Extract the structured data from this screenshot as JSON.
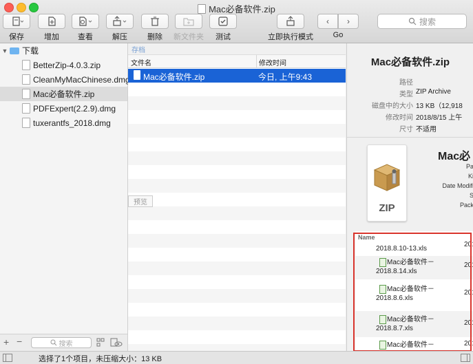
{
  "window": {
    "title": "Mac必备软件.zip"
  },
  "toolbar": {
    "buttons": [
      {
        "label": "保存",
        "icon": "save-icon",
        "enabled": true
      },
      {
        "label": "增加",
        "icon": "add-file-icon",
        "enabled": true
      },
      {
        "label": "查看",
        "icon": "view-icon",
        "enabled": true
      },
      {
        "label": "解压",
        "icon": "extract-icon",
        "enabled": true
      },
      {
        "label": "删除",
        "icon": "trash-icon",
        "enabled": true
      },
      {
        "label": "新文件夹",
        "icon": "new-folder-icon",
        "enabled": false
      },
      {
        "label": "测试",
        "icon": "checkbox-icon",
        "enabled": true
      },
      {
        "label": "立即执行模式",
        "icon": "execute-icon",
        "enabled": true
      },
      {
        "label": "Go",
        "icon": "nav-arrows-icon",
        "enabled": true
      }
    ],
    "search_placeholder": "搜索"
  },
  "sidebar": {
    "root": "下载",
    "items": [
      {
        "label": "BetterZip-4.0.3.zip",
        "selected": false
      },
      {
        "label": "CleanMyMacChinese.dmg",
        "selected": false
      },
      {
        "label": "Mac必备软件.zip",
        "selected": true
      },
      {
        "label": "PDFExpert(2.2.9).dmg",
        "selected": false
      },
      {
        "label": "tuxerantfs_2018.dmg",
        "selected": false
      }
    ],
    "search_placeholder": "搜索"
  },
  "file_list": {
    "archive_tag": "存档",
    "columns": {
      "name": "文件名",
      "modified": "修改时间"
    },
    "rows": [
      {
        "name": "Mac必备软件.zip",
        "modified": "今日, 上午9:43",
        "selected": true
      }
    ],
    "preview_tag": "预览"
  },
  "info": {
    "title": "Mac必备软件.zip",
    "fields": [
      {
        "key": "路径",
        "value": ""
      },
      {
        "key": "类型",
        "value": "ZIP Archive"
      },
      {
        "key": "磁盘中的大小",
        "value": "13 KB（12,918"
      },
      {
        "key": "修改时间",
        "value": "2018/8/15 上午"
      },
      {
        "key": "尺寸",
        "value": "不适用"
      }
    ],
    "preview_title": "Mac必",
    "preview_labels": [
      "Pa",
      "Ki",
      "Date Modifi",
      "S",
      "Pack"
    ],
    "zip_icon_label": "ZIP",
    "list_header": "Name",
    "list_items": [
      {
        "line1": "",
        "line2": "2018.8.10-13.xls",
        "year": "201"
      },
      {
        "line1": "Mac必备软件－",
        "line2": "2018.8.14.xls",
        "year": "201"
      },
      {
        "line1": "Mac必备软件－",
        "line2": "2018.8.6.xls",
        "year": "201"
      },
      {
        "line1": "Mac必备软件－",
        "line2": "2018.8.7.xls",
        "year": "201"
      },
      {
        "line1": "Mac必备软件－",
        "line2": "",
        "year": "201"
      }
    ]
  },
  "status": {
    "text": "选择了1个项目，未压缩大小：13 KB"
  },
  "colors": {
    "selection": "#1a63d6",
    "highlight_box": "#d9332b"
  }
}
